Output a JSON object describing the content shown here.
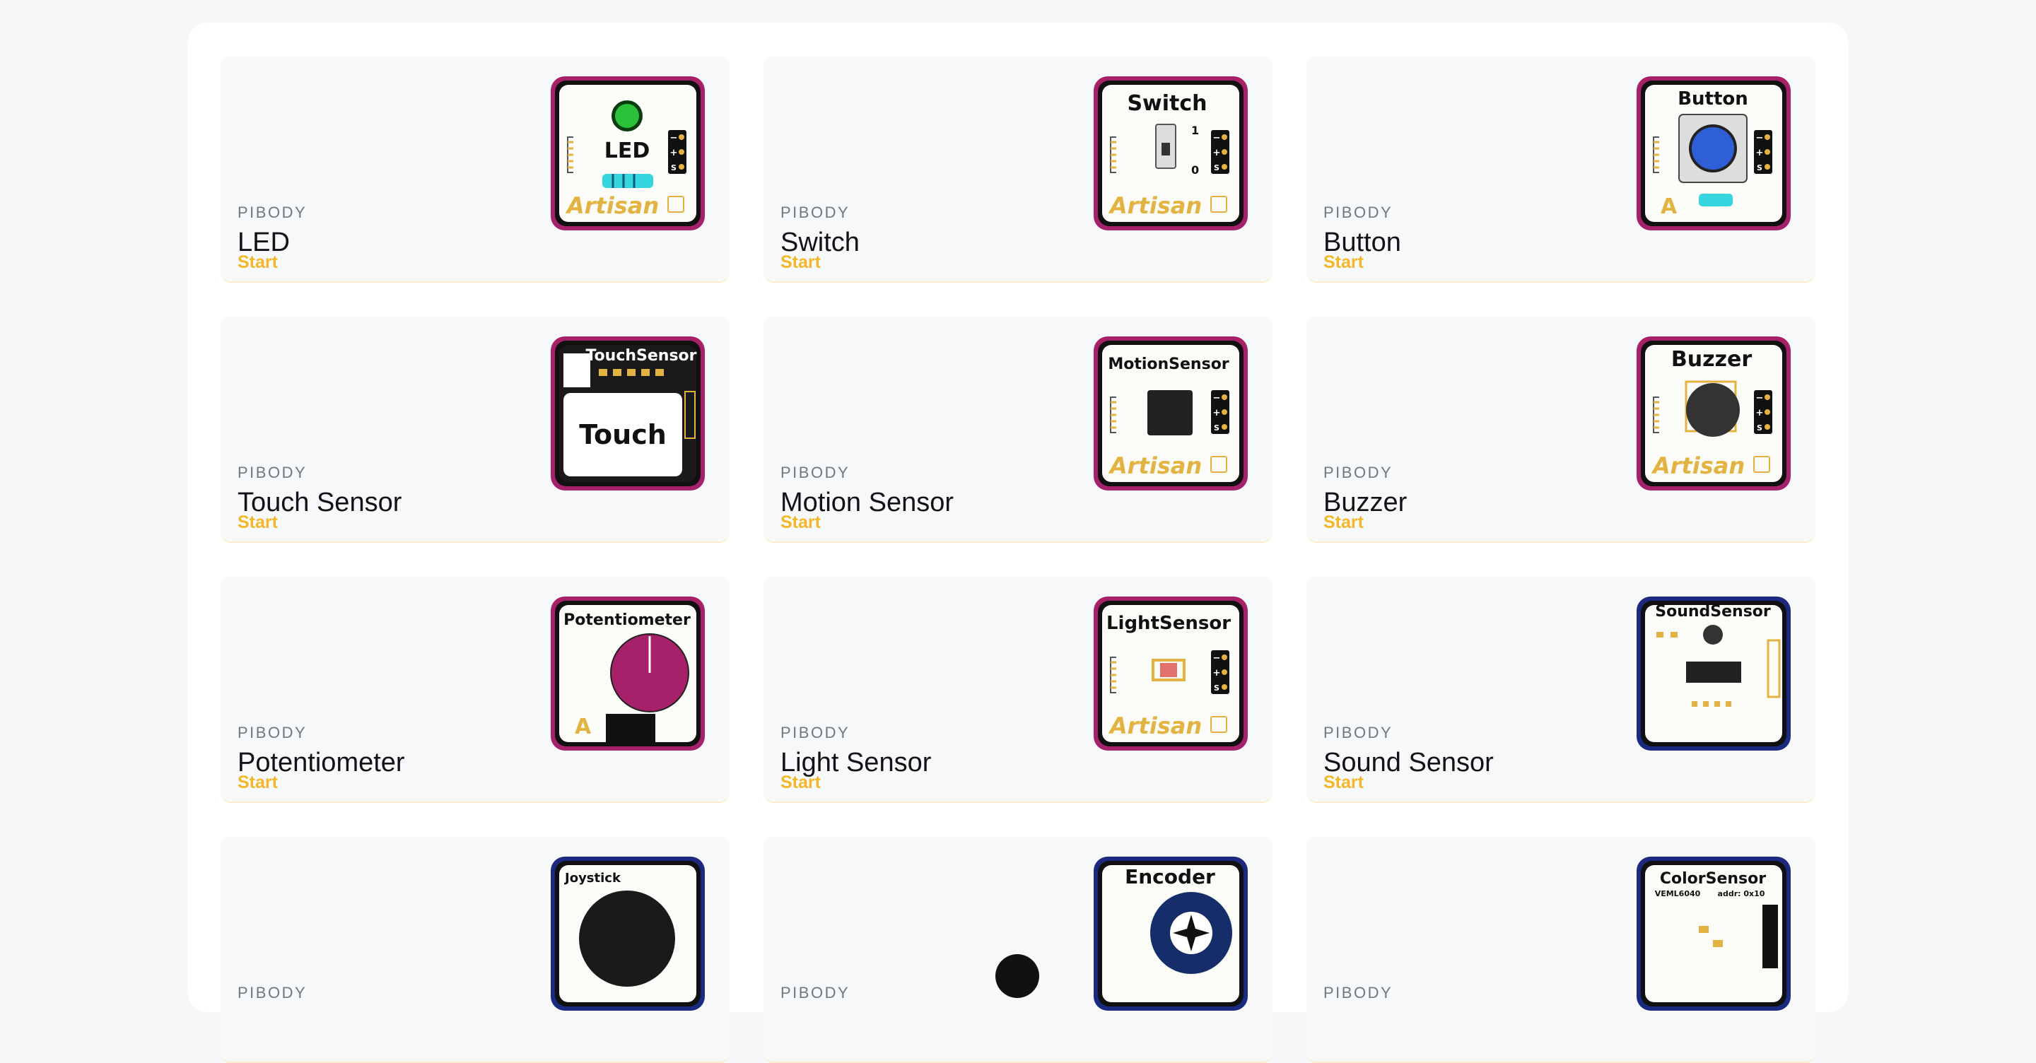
{
  "modules": [
    {
      "brand": "PIBODY",
      "name": "LED",
      "start": "Start",
      "board": "LED",
      "board_color": "#a6216a",
      "icon": "led-board-icon"
    },
    {
      "brand": "PIBODY",
      "name": "Switch",
      "start": "Start",
      "board": "Switch",
      "board_color": "#a6216a",
      "icon": "switch-board-icon"
    },
    {
      "brand": "PIBODY",
      "name": "Button",
      "start": "Start",
      "board": "Button",
      "board_color": "#a6216a",
      "icon": "button-board-icon"
    },
    {
      "brand": "PIBODY",
      "name": "Touch Sensor",
      "start": "Start",
      "board": "TouchSensor",
      "board_color": "#a6216a",
      "icon": "touch-sensor-board-icon"
    },
    {
      "brand": "PIBODY",
      "name": "Motion Sensor",
      "start": "Start",
      "board": "MotionSensor",
      "board_color": "#a6216a",
      "icon": "motion-sensor-board-icon"
    },
    {
      "brand": "PIBODY",
      "name": "Buzzer",
      "start": "Start",
      "board": "Buzzer",
      "board_color": "#a6216a",
      "icon": "buzzer-board-icon"
    },
    {
      "brand": "PIBODY",
      "name": "Potentiometer",
      "start": "Start",
      "board": "Potentiometer",
      "board_color": "#a6216a",
      "icon": "potentiometer-board-icon"
    },
    {
      "brand": "PIBODY",
      "name": "Light Sensor",
      "start": "Start",
      "board": "LightSensor",
      "board_color": "#a6216a",
      "icon": "light-sensor-board-icon"
    },
    {
      "brand": "PIBODY",
      "name": "Sound Sensor",
      "start": "Start",
      "board": "SoundSensor",
      "board_color": "#1b2a80",
      "icon": "sound-sensor-board-icon"
    },
    {
      "brand": "PIBODY",
      "name": "",
      "start": "",
      "board": "Joystick",
      "board_color": "#1b2a80",
      "icon": "joystick-board-icon"
    },
    {
      "brand": "PIBODY",
      "name": "",
      "start": "",
      "board": "Encoder",
      "board_color": "#1b2a80",
      "icon": "encoder-board-icon"
    },
    {
      "brand": "PIBODY",
      "name": "",
      "start": "",
      "board": "ColorSensor",
      "board_color": "#1b2a80",
      "icon": "color-sensor-board-icon"
    }
  ],
  "board_labels": {
    "artisan": "Artisan",
    "touch": "Touch",
    "color_chip": "VEML6040",
    "color_addr": "addr: 0x10",
    "switch_on": "1",
    "switch_off": "0"
  },
  "colors": {
    "accent": "#f2b82a",
    "gold": "#e3b341",
    "led_green": "#2bc13b",
    "button_blue": "#2f5fd6",
    "pot_knob": "#a6216a"
  }
}
